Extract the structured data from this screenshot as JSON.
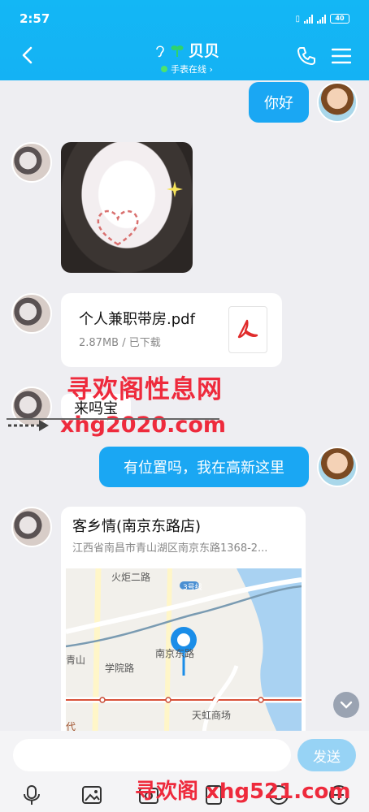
{
  "status": {
    "time": "2:57",
    "battery": "40"
  },
  "header": {
    "name": "贝贝",
    "subtitle": "手表在线 ›"
  },
  "messages": {
    "m1_out": "你好",
    "file": {
      "name": "个人兼职带房.pdf",
      "meta": "2.87MB / 已下载"
    },
    "text_in": "来吗宝",
    "m2_out": "有位置吗，我在高新这里",
    "location": {
      "title": "客乡情(南京东路店)",
      "address": "江西省南昌市青山湖区南京东路1368-2...",
      "map_labels": [
        "火炬二路",
        "3号线",
        "南京东路",
        "学院路",
        "天虹商场",
        "青山",
        "代"
      ]
    }
  },
  "composer": {
    "send_label": "发送"
  },
  "watermarks": {
    "w1": "寻欢阁性息网",
    "w2": "xhg2020.com",
    "w3": "寻欢阁 xhg521.com"
  },
  "colors": {
    "accent": "#1aa7f3",
    "header": "#13b7f5"
  }
}
